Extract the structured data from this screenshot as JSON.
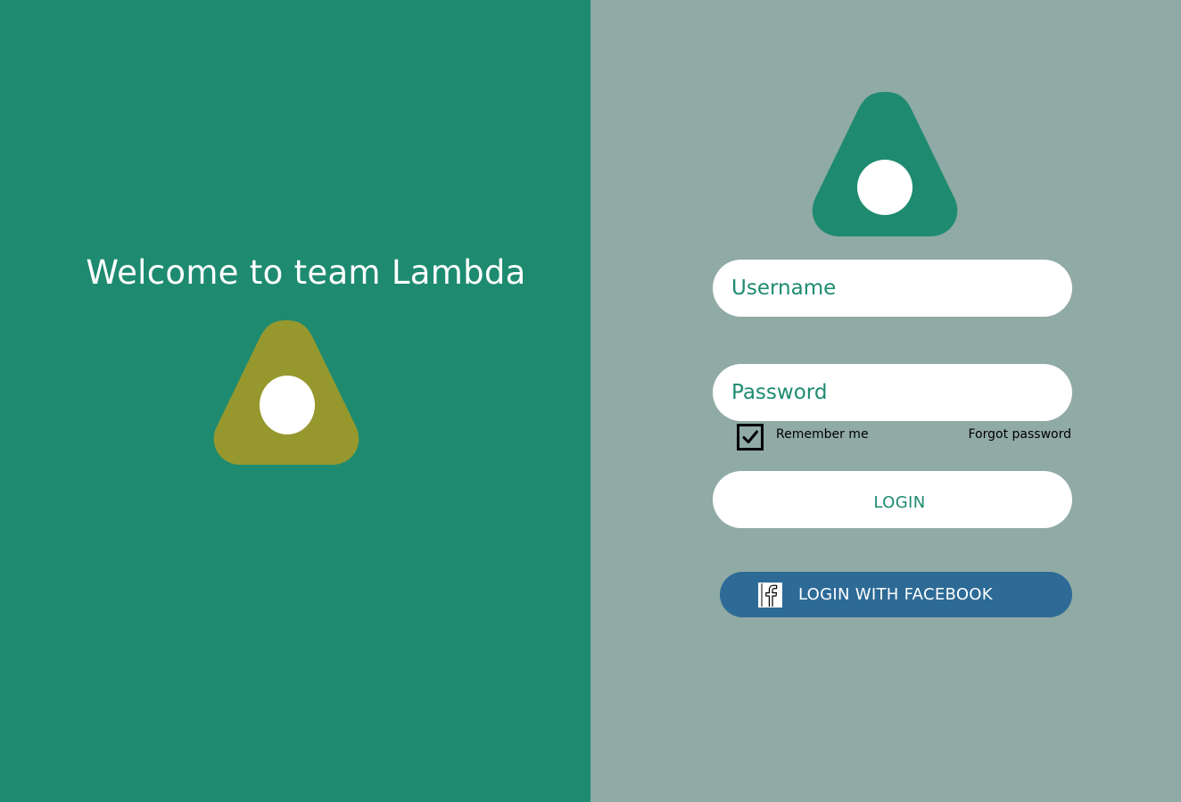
{
  "welcome": {
    "title": "Welcome to team Lambda"
  },
  "login_form": {
    "username_placeholder": "Username",
    "password_placeholder": "Password",
    "remember_me_label": "Remember me",
    "remember_me_checked": true,
    "forgot_password_label": "Forgot password",
    "login_button_label": "LOGIN",
    "facebook_button_label": "LOGIN WITH FACEBOOK"
  },
  "icons": {
    "left_logo": "lambda-logo-icon",
    "right_logo": "lambda-logo-icon",
    "remember_check": "checkmark-icon",
    "facebook": "facebook-icon"
  },
  "colors": {
    "left_background": "#1e8b70",
    "right_background": "#90aaa5",
    "left_logo": "#96982e",
    "right_logo": "#1e8b70",
    "accent_text": "#1e8b70",
    "facebook_button": "#2d6a96"
  }
}
